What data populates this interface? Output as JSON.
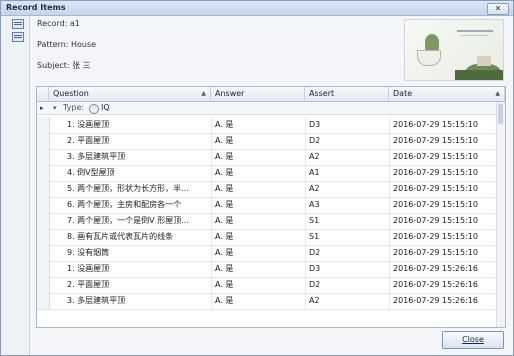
{
  "window": {
    "title": "Record Items",
    "close_glyph": "✕"
  },
  "info": {
    "record": "Record: a1",
    "pattern": "Pattern: House",
    "subject": "Subject: 张 三"
  },
  "grid": {
    "columns": [
      "Question",
      "Answer",
      "Assert",
      "Date"
    ],
    "sort_glyph": "▲",
    "group_label": "Type:",
    "group_value": "IQ",
    "rows": [
      {
        "q": "1. 没画屋顶",
        "a": "A. 是",
        "s": "D3",
        "d": "2016-07-29 15:15:10"
      },
      {
        "q": "2. 平面屋顶",
        "a": "A. 是",
        "s": "D2",
        "d": "2016-07-29 15:15:10"
      },
      {
        "q": "3. 多层建筑平顶",
        "a": "A. 是",
        "s": "A2",
        "d": "2016-07-29 15:15:10"
      },
      {
        "q": "4. 倒V型屋顶",
        "a": "A. 是",
        "s": "A1",
        "d": "2016-07-29 15:15:10"
      },
      {
        "q": "5. 两个屋顶，形状为长方形，半...",
        "a": "A. 是",
        "s": "A2",
        "d": "2016-07-29 15:15:10"
      },
      {
        "q": "6. 两个屋顶，主房和配房各一个",
        "a": "A. 是",
        "s": "A3",
        "d": "2016-07-29 15:15:10"
      },
      {
        "q": "7. 两个屋顶，一个是倒V 形屋顶...",
        "a": "A. 是",
        "s": "S1",
        "d": "2016-07-29 15:15:10"
      },
      {
        "q": "8. 画有瓦片或代表瓦片的线条",
        "a": "A. 是",
        "s": "S1",
        "d": "2016-07-29 15:15:10"
      },
      {
        "q": "9. 没有烟筒",
        "a": "A. 是",
        "s": "D2",
        "d": "2016-07-29 15:15:10"
      },
      {
        "q": "1. 没画屋顶",
        "a": "A. 是",
        "s": "D3",
        "d": "2016-07-29 15:26:16"
      },
      {
        "q": "2. 平面屋顶",
        "a": "A. 是",
        "s": "D2",
        "d": "2016-07-29 15:26:16"
      },
      {
        "q": "3. 多层建筑平顶",
        "a": "A. 是",
        "s": "A2",
        "d": "2016-07-29 15:26:16"
      }
    ]
  },
  "footer": {
    "close_label": "Close"
  }
}
